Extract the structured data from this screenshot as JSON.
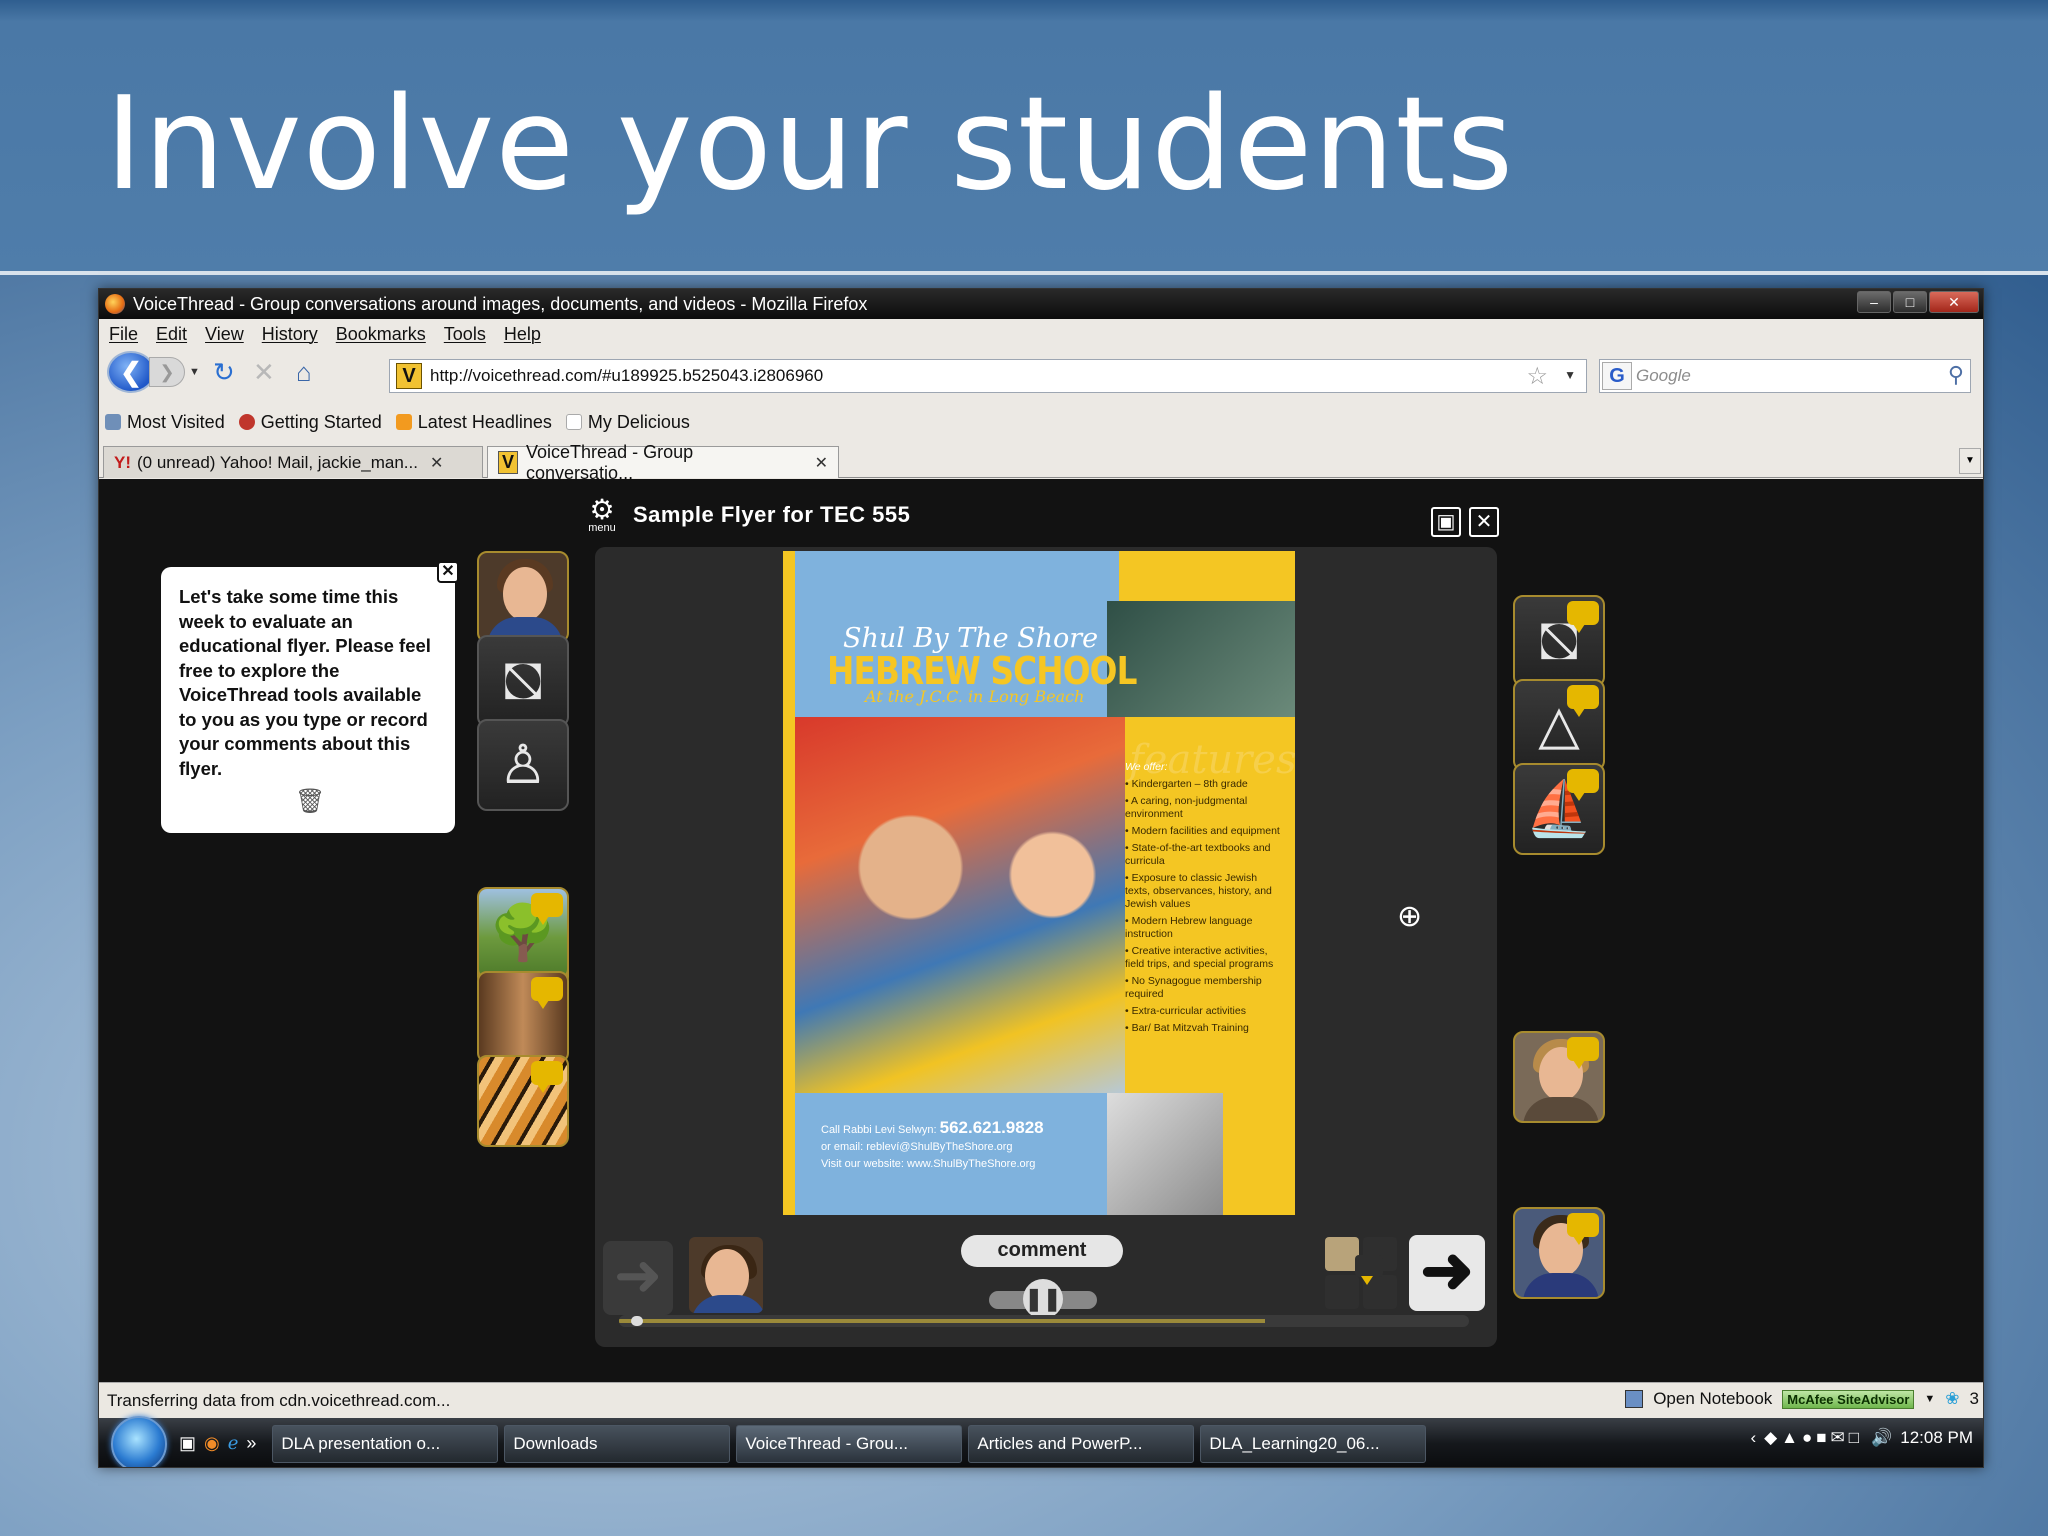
{
  "slide": {
    "title": "Involve your students"
  },
  "window": {
    "title": "VoiceThread - Group conversations around images, documents, and videos - Mozilla Firefox",
    "controls": [
      "–",
      "□",
      "✕"
    ]
  },
  "menu": [
    "File",
    "Edit",
    "View",
    "History",
    "Bookmarks",
    "Tools",
    "Help"
  ],
  "nav": {
    "url": "http://voicethread.com/#u189925.b525043.i2806960",
    "site_icon": "V",
    "search_placeholder": "Google",
    "search_engine_icon": "G"
  },
  "bookmarks": [
    {
      "label": "Most Visited",
      "icon": "most-visited-icon",
      "color": "#6f8fb8"
    },
    {
      "label": "Getting Started",
      "icon": "firefox-getting-started-icon",
      "color": "#c0362c"
    },
    {
      "label": "Latest Headlines",
      "icon": "rss-icon",
      "color": "#f29a1f"
    },
    {
      "label": "My Delicious",
      "icon": "page-icon",
      "color": "#e7e7e7"
    }
  ],
  "tabs": [
    {
      "label": "(0 unread) Yahoo! Mail, jackie_man...",
      "icon": "yahoo-icon",
      "active": false
    },
    {
      "label": "VoiceThread - Group conversatio...",
      "icon": "voicethread-icon",
      "active": true
    }
  ],
  "voicethread": {
    "menu_label": "menu",
    "title": "Sample Flyer for TEC 555",
    "comment_text": "Let's take some time this week to evaluate an educational flyer.  Please feel free to explore the VoiceThread tools available to you as you type or record your comments about this flyer.",
    "comment_button": "comment",
    "left_avatars": [
      "woman-short-hair",
      "hat-icon",
      "chess-pawn-icon",
      "woman-blonde",
      "tree-photo",
      "corridor-photo",
      "tiger-photo"
    ],
    "right_avatars": [
      "hat-icon",
      "thimble-icon",
      "boat-icon",
      "woman-glasses",
      "man-photo",
      "woman-smiling"
    ],
    "flyer": {
      "line1": "Shul By The Shore",
      "line2": "HEBREW SCHOOL",
      "line3": "At the J.C.C. in Long Beach",
      "features_heading": "features",
      "we_offer": "We offer:",
      "items": [
        "• Kindergarten – 8th grade",
        "• A caring, non-judgmental environment",
        "• Modern facilities and equipment",
        "• State-of-the-art textbooks and curricula",
        "• Exposure to classic Jewish texts, observances, history, and Jewish values",
        "• Modern Hebrew language instruction",
        "• Creative interactive activities, field trips, and special programs",
        "• No Synagogue membership required",
        "• Extra-curricular activities",
        "• Bar/ Bat Mitzvah Training"
      ],
      "call_label": "Call Rabbi Levi Selwyn:",
      "phone": "562.621.9828",
      "email_label": "or email:",
      "email": "rebleví@ShulByTheShore.org",
      "web_label": "Visit our website:",
      "web": "www.ShulByTheShore.org"
    },
    "timeline_progress": 0.06
  },
  "status": {
    "text": "Transferring data from cdn.voicethread.com...",
    "notebook": "Open Notebook",
    "mcafee": "McAfee SiteAdvisor",
    "count": "3"
  },
  "taskbar": {
    "tasks": [
      {
        "label": "DLA presentation o...",
        "active": false
      },
      {
        "label": "Downloads",
        "active": false
      },
      {
        "label": "VoiceThread - Grou...",
        "active": true
      },
      {
        "label": "Articles and PowerP...",
        "active": false
      },
      {
        "label": "DLA_Learning20_06...",
        "active": false
      }
    ],
    "clock": "12:08 PM"
  },
  "colors": {
    "accent_gold": "#e5b700",
    "slide_blue": "#4f7daa"
  }
}
